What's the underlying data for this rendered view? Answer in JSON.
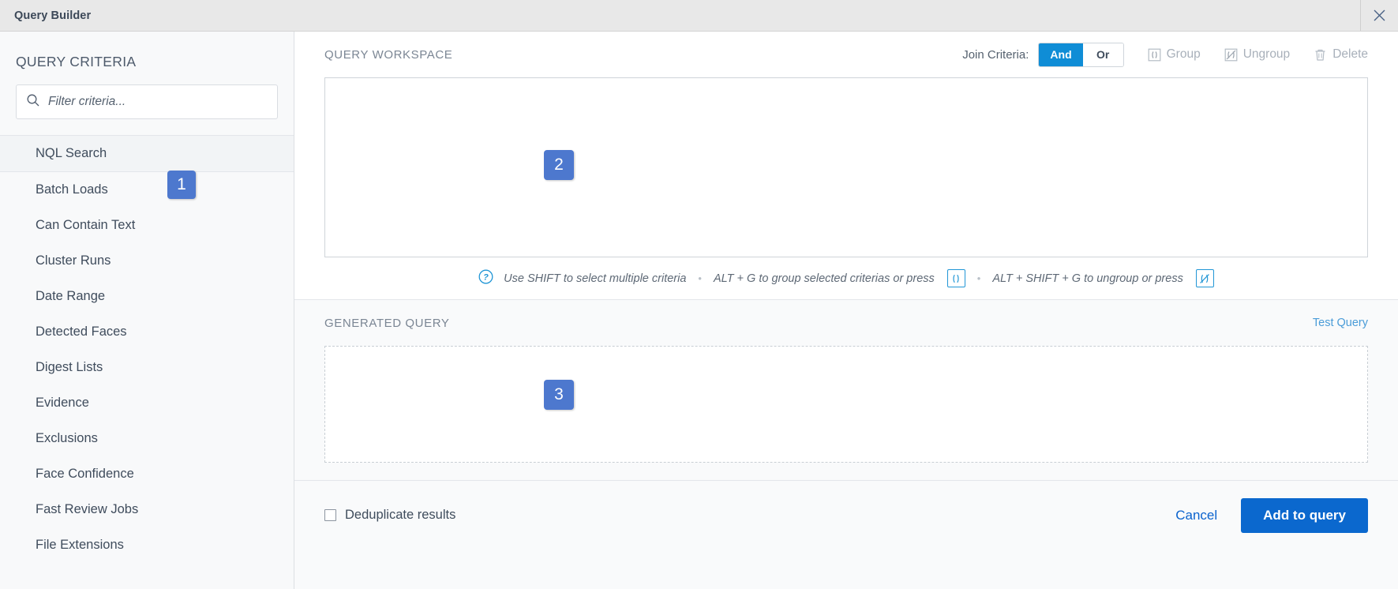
{
  "window": {
    "title": "Query Builder",
    "close_icon": "close-icon"
  },
  "sidebar": {
    "title": "QUERY CRITERIA",
    "search": {
      "placeholder": "Filter criteria...",
      "value": "",
      "icon": "search-icon"
    },
    "selected_item": "NQL Search",
    "items": [
      {
        "label": "NQL Search",
        "selected": true
      },
      {
        "label": "Batch Loads",
        "selected": false
      },
      {
        "label": "Can Contain Text",
        "selected": false
      },
      {
        "label": "Cluster Runs",
        "selected": false
      },
      {
        "label": "Date Range",
        "selected": false
      },
      {
        "label": "Detected Faces",
        "selected": false
      },
      {
        "label": "Digest Lists",
        "selected": false
      },
      {
        "label": "Evidence",
        "selected": false
      },
      {
        "label": "Exclusions",
        "selected": false
      },
      {
        "label": "Face Confidence",
        "selected": false
      },
      {
        "label": "Fast Review Jobs",
        "selected": false
      },
      {
        "label": "File Extensions",
        "selected": false
      }
    ]
  },
  "markers": [
    {
      "number": "1"
    },
    {
      "number": "2"
    },
    {
      "number": "3"
    }
  ],
  "workspace": {
    "label": "QUERY WORKSPACE",
    "join_criteria_label": "Join Criteria:",
    "join_options": [
      {
        "label": "And",
        "active": true
      },
      {
        "label": "Or",
        "active": false
      }
    ],
    "tools": [
      {
        "label": "Group",
        "icon": "group-icon",
        "enabled": false
      },
      {
        "label": "Ungroup",
        "icon": "ungroup-icon",
        "enabled": false
      },
      {
        "label": "Delete",
        "icon": "trash-icon",
        "enabled": false
      }
    ],
    "content": ""
  },
  "hints": {
    "icon": "help-circle-icon",
    "text_1": "Use SHIFT to select multiple criteria",
    "separator": "•",
    "text_2": "ALT + G to group selected criterias or press",
    "badge_1": "group-key-icon",
    "text_3": "ALT + SHIFT + G to ungroup or press",
    "badge_2": "ungroup-key-icon"
  },
  "generated": {
    "label": "GENERATED QUERY",
    "test_query_label": "Test Query",
    "content": ""
  },
  "footer": {
    "deduplicate_label": "Deduplicate results",
    "deduplicate_checked": false,
    "cancel_label": "Cancel",
    "submit_label": "Add to query"
  },
  "colors": {
    "accent_blue": "#0b68ce",
    "toggle_active": "#0f8dd6",
    "marker_blue": "#4d78ce",
    "link_blue": "#4a9cd8",
    "titlebar_bg": "#e8e8e8",
    "sidebar_bg": "#f8f9fa"
  }
}
